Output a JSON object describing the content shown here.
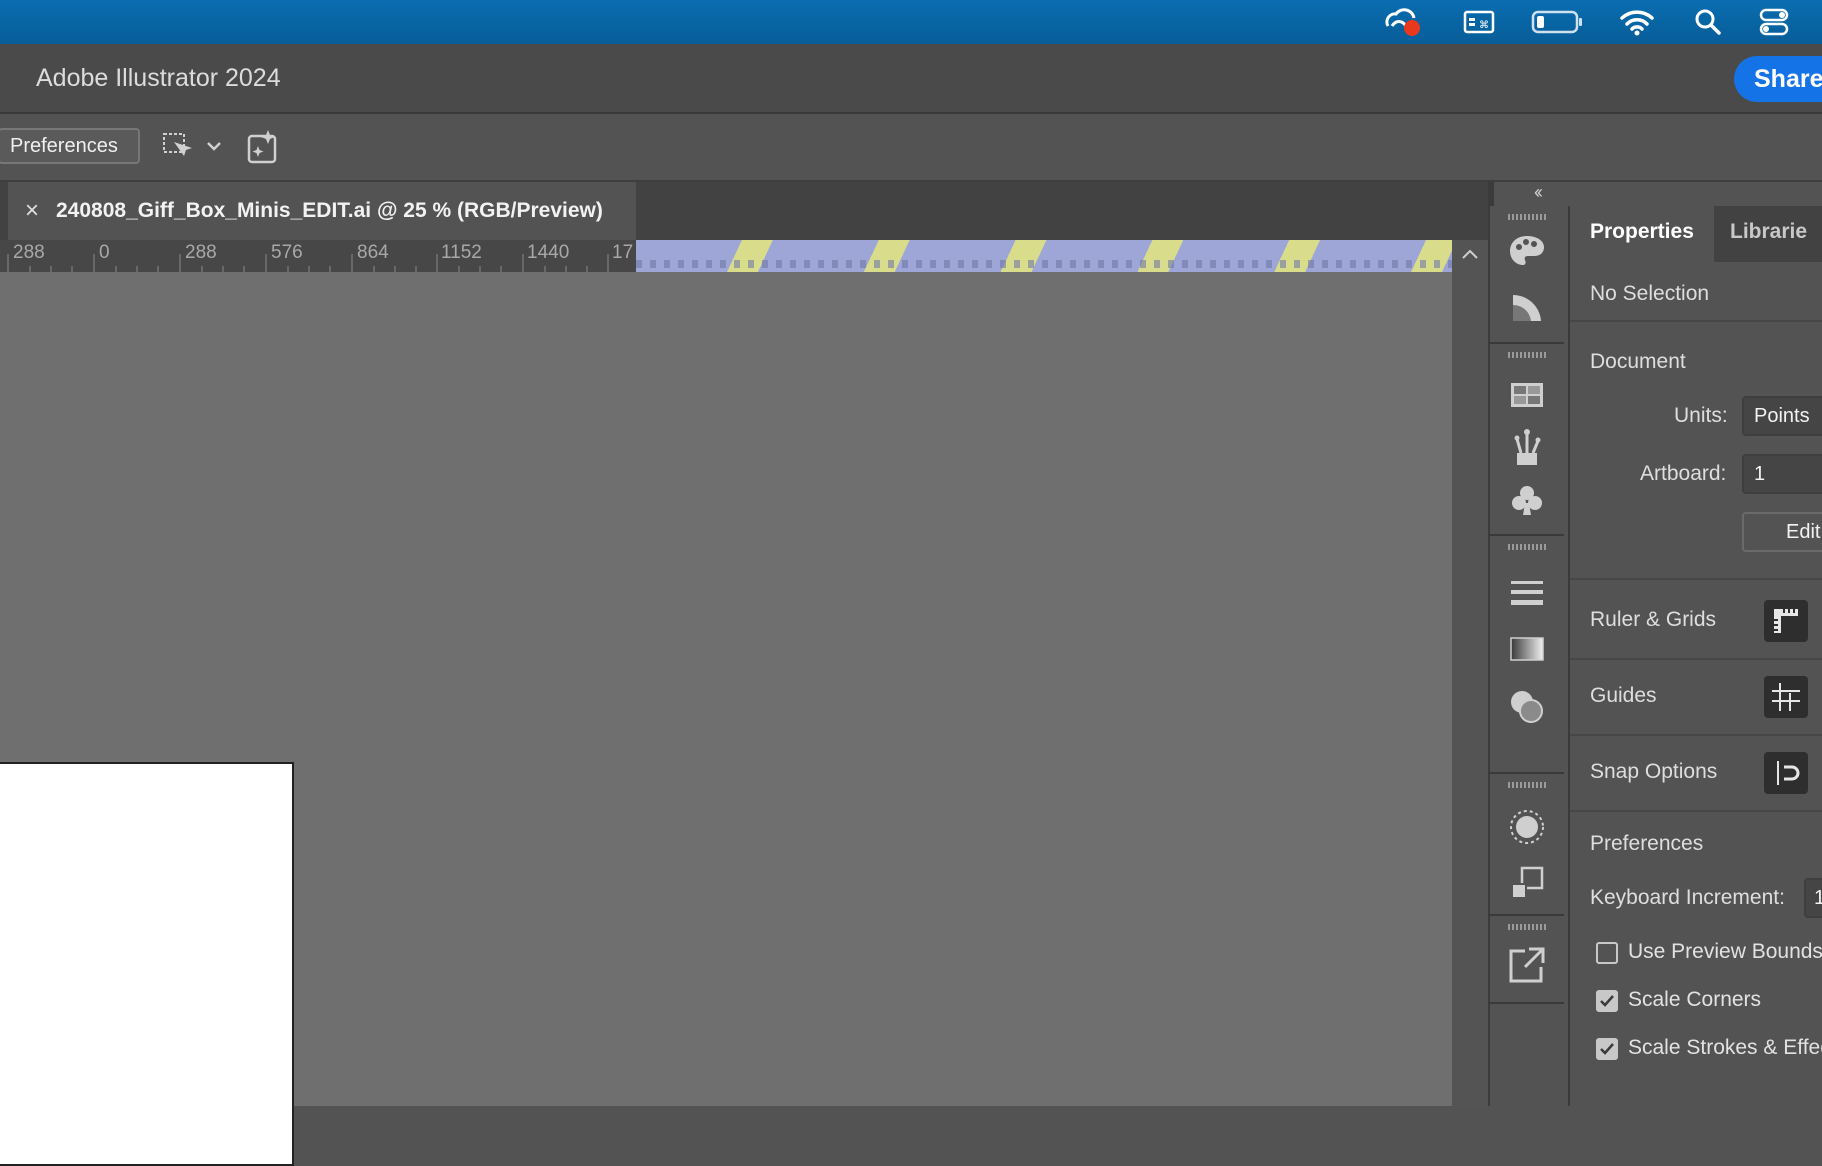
{
  "app": {
    "title": "Adobe Illustrator 2024",
    "share_label": "Share"
  },
  "menubar": {
    "icons": [
      "creative-cloud-icon",
      "keyboard-input-icon",
      "battery-icon",
      "wifi-icon",
      "spotlight-search-icon",
      "control-center-icon"
    ]
  },
  "controlbar": {
    "preferences_label": "Preferences"
  },
  "document": {
    "tab_title": "240808_Giff_Box_Minis_EDIT.ai @ 25 % (RGB/Preview)",
    "close_glyph": "×"
  },
  "ruler": {
    "ticks": [
      "288",
      "0",
      "288",
      "576",
      "864",
      "1152",
      "1440",
      "17"
    ]
  },
  "canvas": {
    "collapse_glyph": "‹‹",
    "scroll_up_glyph": "^"
  },
  "properties": {
    "tabs": [
      "Properties",
      "Librarie"
    ],
    "selection_state": "No Selection",
    "document_heading": "Document",
    "units_label": "Units:",
    "units_value": "Points",
    "artboard_label": "Artboard:",
    "artboard_value": "1",
    "edit_label": "Edit",
    "ruler_grids": "Ruler & Grids",
    "guides": "Guides",
    "snap_options": "Snap Options",
    "preferences_heading": "Preferences",
    "keyboard_increment_label": "Keyboard Increment:",
    "keyboard_increment_value": "1",
    "checkboxes": [
      {
        "label": "Use Preview Bounds",
        "checked": false
      },
      {
        "label": "Scale Corners",
        "checked": true
      },
      {
        "label": "Scale Strokes & Effec",
        "checked": true
      }
    ]
  }
}
